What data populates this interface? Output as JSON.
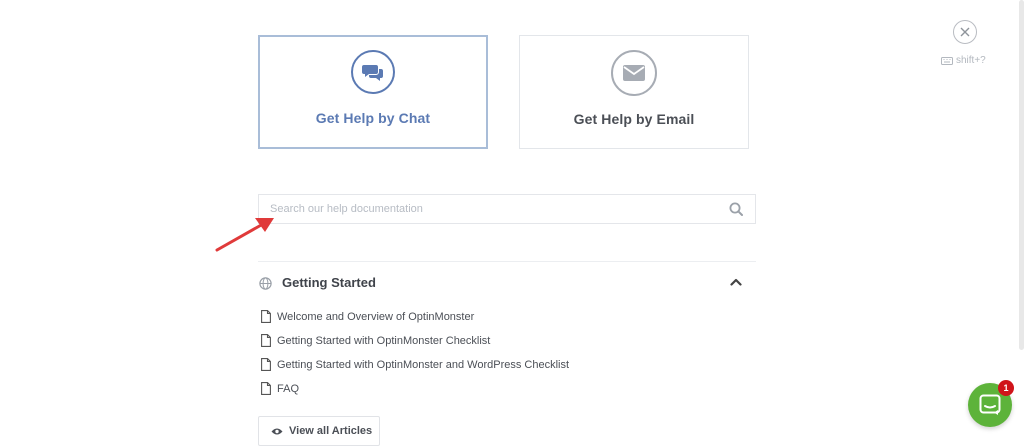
{
  "cards": {
    "chat": {
      "label": "Get Help by Chat",
      "icon": "chat-bubbles-icon"
    },
    "email": {
      "label": "Get Help by Email",
      "icon": "envelope-icon"
    }
  },
  "close": {
    "icon": "close-icon"
  },
  "shortcut": {
    "icon": "keyboard-icon",
    "text": "shift+?"
  },
  "search": {
    "placeholder": "Search our help documentation",
    "value": "",
    "icon": "search-icon"
  },
  "section": {
    "title": "Getting Started",
    "icon": "globe-icon",
    "expanded": true,
    "articles": [
      "Welcome and Overview of OptinMonster",
      "Getting Started with OptinMonster Checklist",
      "Getting Started with OptinMonster and WordPress Checklist",
      "FAQ"
    ]
  },
  "view_all": {
    "label": "View all Articles",
    "icon": "eye-icon"
  },
  "chat_widget": {
    "badge": "1",
    "icon": "chat-icon"
  },
  "colors": {
    "accent": "#5b7ab3",
    "launcher": "#5db33a",
    "badge": "#d0141a",
    "arrow": "#e03a3a"
  }
}
